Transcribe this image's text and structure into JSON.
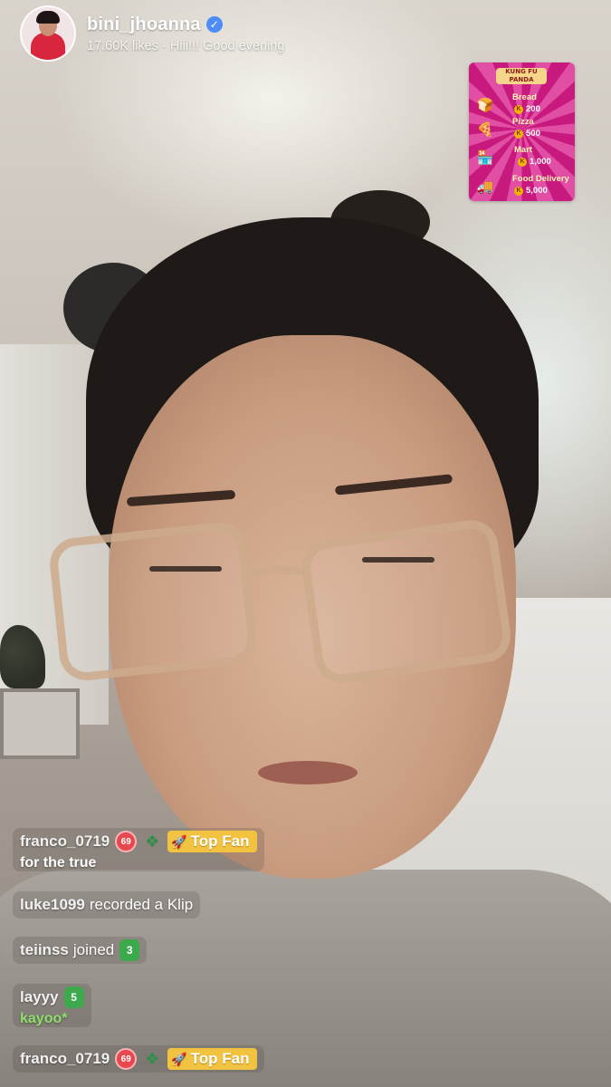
{
  "host": {
    "username": "bini_jhoanna",
    "subtitle": "17.60K likes · Hiii!!! Good evening"
  },
  "gift_menu": {
    "logo_text": "KUNG FU PANDA",
    "items": [
      {
        "name": "Bread",
        "price": "200",
        "icon": "bread-icon"
      },
      {
        "name": "Pizza",
        "price": "500",
        "icon": "pizza-icon"
      },
      {
        "name": "Mart",
        "price": "1,000",
        "icon": "mart-icon"
      },
      {
        "name": "Food Delivery",
        "price": "5,000",
        "icon": "delivery-truck-icon"
      }
    ]
  },
  "chat": {
    "messages": [
      {
        "user": "franco_0719",
        "level": "69",
        "badge": "Top Fan",
        "text": "for the true"
      },
      {
        "user": "luke1099",
        "event": "recorded a Klip"
      },
      {
        "user": "teiinss",
        "event": "joined",
        "bag": "3"
      },
      {
        "user": "layyy",
        "bag": "5",
        "text": "kayoo*"
      },
      {
        "user": "franco_0719",
        "level": "69",
        "badge": "Top Fan"
      }
    ]
  },
  "colors": {
    "verified": "#4e8cf7",
    "top_fan_badge": "#f2c341",
    "level_badge": "#e7484e",
    "green_text": "#8de06b",
    "gift_menu_bg": "#c8197e"
  }
}
